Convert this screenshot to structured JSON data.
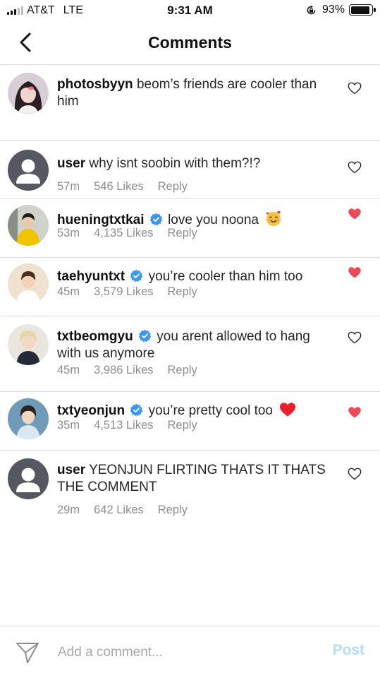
{
  "status_bar": {
    "carrier": "AT&T",
    "network": "LTE",
    "time": "9:31 AM",
    "battery": "93%",
    "battery_level": 0.93
  },
  "nav": {
    "back_icon": "chevron-left-icon",
    "title": "Comments"
  },
  "colors": {
    "heart_liked": "#ed4956",
    "verified": "#3897f0",
    "post_disabled": "#b3dbff"
  },
  "comments": [
    {
      "username": "photosbyyn",
      "text": "beom’s friends are cooler than him",
      "verified": false,
      "liked": false
    },
    {
      "username": "user",
      "text": "why isnt soobin with them?!?",
      "verified": false,
      "time": "57m",
      "likes": "546 Likes",
      "reply": "Reply",
      "liked": false
    },
    {
      "username": "hueningtxtkai",
      "text": "love you noona",
      "verified": true,
      "emoji": "smiling-face-with-hearts",
      "time": "53m",
      "likes": "4,135 Likes",
      "reply": "Reply",
      "liked": true
    },
    {
      "username": "taehyuntxt",
      "text": "you’re cooler than him too",
      "verified": true,
      "time": "45m",
      "likes": "3,579 Likes",
      "reply": "Reply",
      "liked": true
    },
    {
      "username": "txtbeomgyu",
      "text": "you arent allowed to hang with us anymore",
      "verified": true,
      "time": "45m",
      "likes": "3,986 Likes",
      "reply": "Reply",
      "liked": false
    },
    {
      "username": "txtyeonjun",
      "text": "you’re pretty cool too",
      "verified": true,
      "emoji": "red-heart",
      "time": "35m",
      "likes": "4,513 Likes",
      "reply": "Reply",
      "liked": true
    },
    {
      "username": "user",
      "text": "YEONJUN FLIRTING THATS IT THATS THE COMMENT",
      "verified": false,
      "time": "29m",
      "likes": "642 Likes",
      "reply": "Reply",
      "liked": false
    }
  ],
  "input": {
    "placeholder": "Add a comment...",
    "value": "",
    "post_label": "Post"
  }
}
